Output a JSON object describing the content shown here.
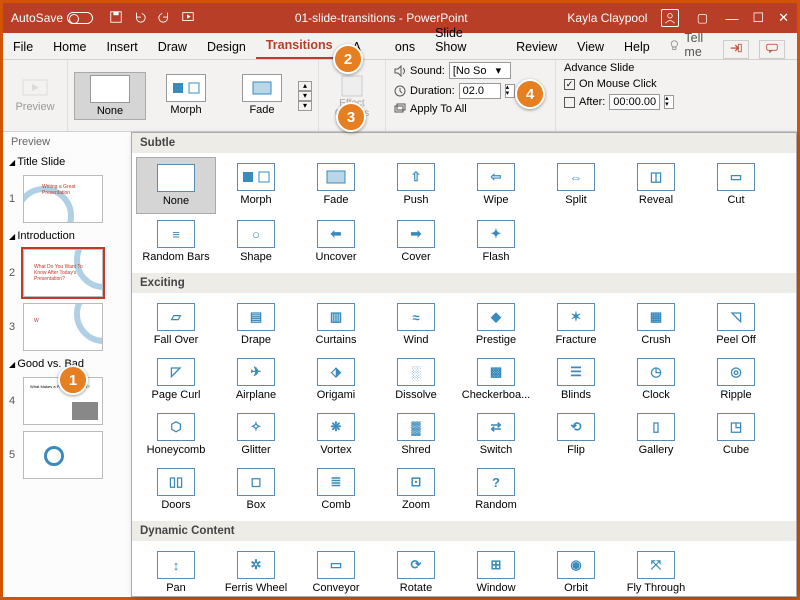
{
  "titlebar": {
    "autosave": "AutoSave",
    "doc": "01-slide-transitions",
    "app": "PowerPoint",
    "user": "Kayla Claypool"
  },
  "tabs": {
    "file": "File",
    "home": "Home",
    "insert": "Insert",
    "draw": "Draw",
    "design": "Design",
    "transitions": "Transitions",
    "animations": "A          ons",
    "slideshow": "Slide Show",
    "review": "Review",
    "view": "View",
    "help": "Help",
    "tellme": "Tell me"
  },
  "ribbon": {
    "preview": "Preview",
    "gallery": [
      {
        "label": "None"
      },
      {
        "label": "Morph"
      },
      {
        "label": "Fade"
      }
    ],
    "effect": "Effect Options",
    "sound": "Sound:",
    "sound_val": "[No So",
    "duration": "Duration:",
    "duration_val": "02.0",
    "applyall": "Apply To All",
    "advance": "Advance Slide",
    "onclick": "On Mouse Click",
    "after": "After:",
    "after_val": "00:00.00"
  },
  "panel": {
    "preview": "Preview",
    "sec1": "Title Slide",
    "sec2": "Introduction",
    "sec3": "Good vs. Bad",
    "n1": "1",
    "n2": "2",
    "n3": "3",
    "n4": "4",
    "n5": "5"
  },
  "dd": {
    "subtle": "Subtle",
    "exciting": "Exciting",
    "dynamic": "Dynamic Content",
    "s": [
      "None",
      "Morph",
      "Fade",
      "Push",
      "Wipe",
      "Split",
      "Reveal",
      "Cut",
      "Random Bars",
      "Shape",
      "Uncover",
      "Cover",
      "Flash"
    ],
    "e": [
      "Fall Over",
      "Drape",
      "Curtains",
      "Wind",
      "Prestige",
      "Fracture",
      "Crush",
      "Peel Off",
      "Page Curl",
      "Airplane",
      "Origami",
      "Dissolve",
      "Checkerboa...",
      "Blinds",
      "Clock",
      "Ripple",
      "Honeycomb",
      "Glitter",
      "Vortex",
      "Shred",
      "Switch",
      "Flip",
      "Gallery",
      "Cube",
      "Doors",
      "Box",
      "Comb",
      "Zoom",
      "Random"
    ],
    "d": [
      "Pan",
      "Ferris Wheel",
      "Conveyor",
      "Rotate",
      "Window",
      "Orbit",
      "Fly Through"
    ]
  },
  "callouts": {
    "c1": "1",
    "c2": "2",
    "c3": "3",
    "c4": "4"
  }
}
